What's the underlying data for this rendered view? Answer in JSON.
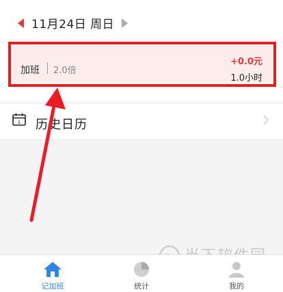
{
  "date_nav": {
    "date_label": "11月24日  周日"
  },
  "record": {
    "type_label": "加班",
    "multiplier": "2.0倍",
    "amount": "+0.0元",
    "hours": "1.0小时"
  },
  "history": {
    "label": "历史日历",
    "calendar_digit": "1"
  },
  "tabs": [
    {
      "label": "记加班",
      "icon": "home-icon",
      "active": true
    },
    {
      "label": "统计",
      "icon": "pie-chart-icon",
      "active": false
    },
    {
      "label": "我的",
      "icon": "user-icon",
      "active": false
    }
  ],
  "watermark": {
    "text": "当下软件园",
    "url": "www.downxia.com"
  },
  "colors": {
    "accent_red": "#e03a3a",
    "highlight_border": "#e51e24",
    "active_tab": "#2f86e6",
    "inactive_tab": "#555555"
  }
}
